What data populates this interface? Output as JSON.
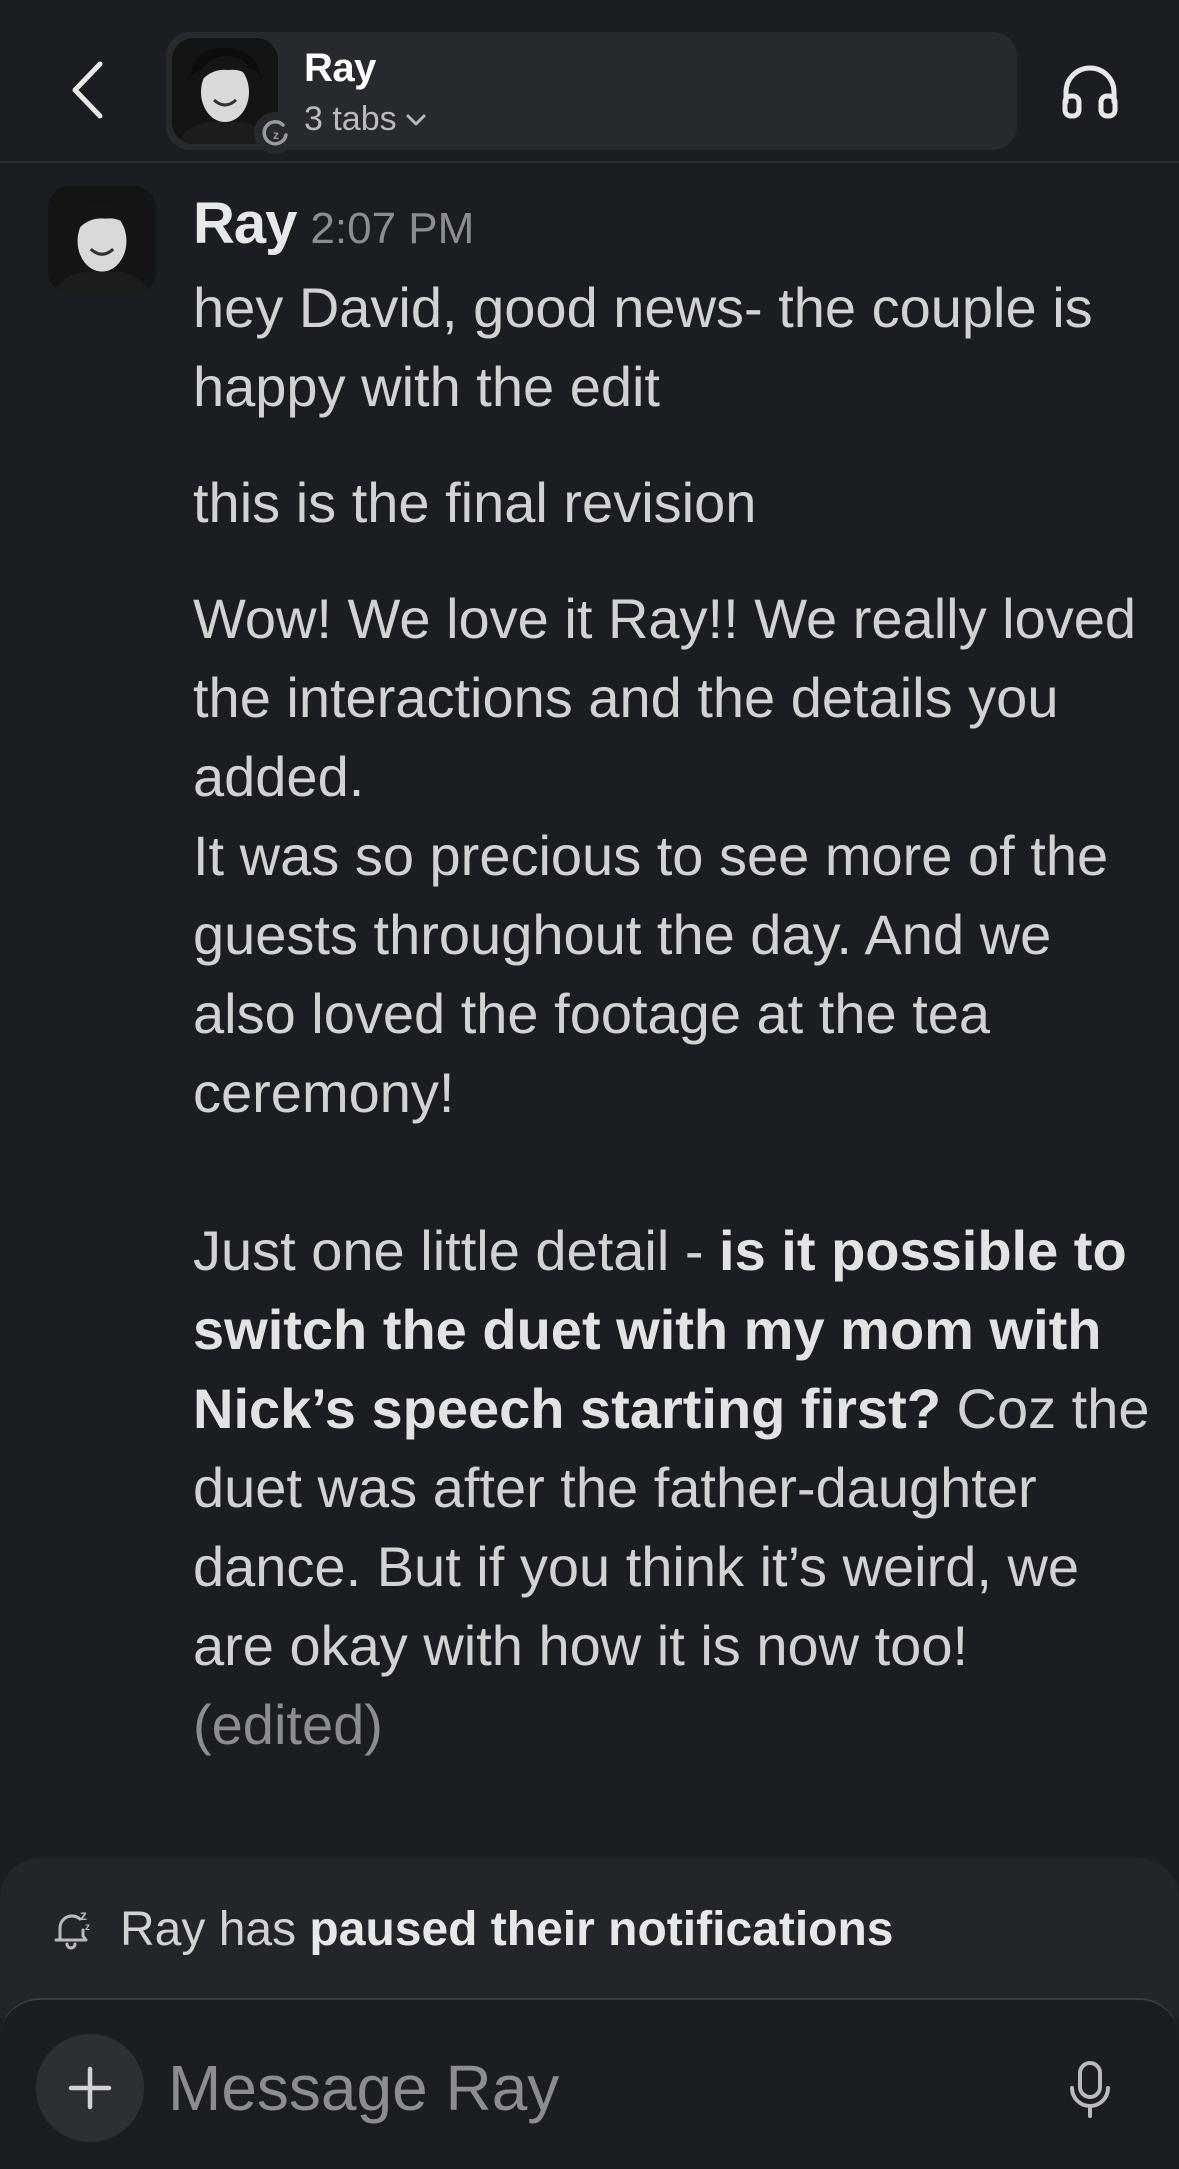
{
  "header": {
    "name": "Ray",
    "subtitle": "3 tabs",
    "back_icon": "chevron-left-icon",
    "call_icon": "headphones-icon"
  },
  "message": {
    "author": "Ray",
    "time": "2:07 PM",
    "line1": "hey David, good news- the couple is happy with the edit",
    "line2": "this is the final revision",
    "para1": "Wow! We love it Ray!! We really loved the interactions and the details you added.",
    "para2": "It was so precious to see more of the guests throughout the day. And we also loved the footage at the tea ceremony!",
    "para3_start": "Just one little detail - ",
    "para3_bold": "is it possible to switch the duet with my mom with Nick’s speech starting first?",
    "para3_end": " Coz the duet was after the father-daughter dance. But if you think it’s weird, we are okay with how it is now too!",
    "edited": "(edited)"
  },
  "notice": {
    "prefix": "Ray has ",
    "bold": "paused their notifications"
  },
  "composer": {
    "placeholder": "Message Ray"
  },
  "colors": {
    "background": "#1a1d21",
    "pill": "#26292e",
    "text": "#d1d2d3",
    "muted": "#8b8d91"
  }
}
